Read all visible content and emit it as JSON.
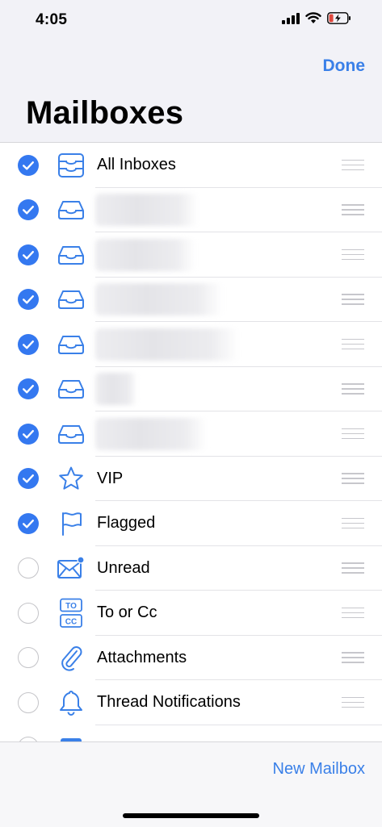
{
  "status": {
    "time": "4:05"
  },
  "header": {
    "done_label": "Done",
    "title": "Mailboxes"
  },
  "mailboxes": [
    {
      "label": "All Inboxes",
      "checked": true,
      "icon": "all-inboxes-icon",
      "redacted": false
    },
    {
      "label": "",
      "checked": true,
      "icon": "inbox-icon",
      "redacted": true
    },
    {
      "label": "",
      "checked": true,
      "icon": "inbox-icon",
      "redacted": true
    },
    {
      "label": "",
      "checked": true,
      "icon": "inbox-icon",
      "redacted": true
    },
    {
      "label": "",
      "checked": true,
      "icon": "inbox-icon",
      "redacted": true
    },
    {
      "label": "",
      "checked": true,
      "icon": "inbox-icon",
      "redacted": true
    },
    {
      "label": "",
      "checked": true,
      "icon": "inbox-icon",
      "redacted": true
    },
    {
      "label": "VIP",
      "checked": true,
      "icon": "star-icon",
      "redacted": false
    },
    {
      "label": "Flagged",
      "checked": true,
      "icon": "flag-icon",
      "redacted": false
    },
    {
      "label": "Unread",
      "checked": false,
      "icon": "unread-envelope-icon",
      "redacted": false
    },
    {
      "label": "To or Cc",
      "checked": false,
      "icon": "to-cc-icon",
      "redacted": false
    },
    {
      "label": "Attachments",
      "checked": false,
      "icon": "paperclip-icon",
      "redacted": false
    },
    {
      "label": "Thread Notifications",
      "checked": false,
      "icon": "bell-icon",
      "redacted": false
    },
    {
      "label": "",
      "checked": false,
      "icon": "calendar-icon",
      "redacted": false
    }
  ],
  "footer": {
    "new_mailbox_label": "New Mailbox"
  },
  "colors": {
    "accent": "#3478f0",
    "link": "#3a80e8",
    "battery_charging": "#e0483e"
  }
}
